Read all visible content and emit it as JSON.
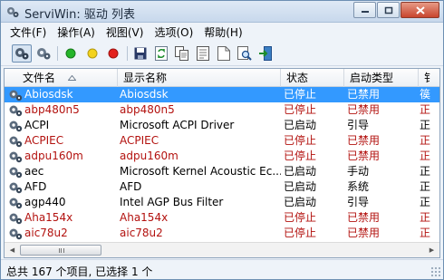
{
  "window": {
    "title": "ServiWin: 驱动 列表",
    "app_icon": "gears-icon"
  },
  "menu": [
    "文件(F)",
    "操作(A)",
    "视图(V)",
    "选项(O)",
    "帮助(H)"
  ],
  "toolbar": {
    "buttons": [
      {
        "name": "drivers-view-icon",
        "pressed": true
      },
      {
        "name": "services-view-icon",
        "pressed": false
      },
      {
        "name": "start-green-icon",
        "pressed": false
      },
      {
        "name": "pause-yellow-icon",
        "pressed": false
      },
      {
        "name": "stop-red-icon",
        "pressed": false
      },
      {
        "name": "save-icon",
        "pressed": false
      },
      {
        "name": "refresh-icon",
        "pressed": false
      },
      {
        "name": "copy-icon",
        "pressed": false
      },
      {
        "name": "properties-icon",
        "pressed": false
      },
      {
        "name": "html-report-icon",
        "pressed": false
      },
      {
        "name": "find-icon",
        "pressed": false
      },
      {
        "name": "exit-icon",
        "pressed": false
      }
    ]
  },
  "columns": [
    "文件名",
    "显示名称",
    "状态",
    "启动类型",
    "钅"
  ],
  "sort_arrow": "up",
  "rows": [
    {
      "file": "Abiosdsk",
      "display": "Abiosdsk",
      "state": "已停止",
      "start": "已禁用",
      "extra": "篌",
      "red": true,
      "selected": true
    },
    {
      "file": "abp480n5",
      "display": "abp480n5",
      "state": "已停止",
      "start": "已禁用",
      "extra": "正",
      "red": true,
      "selected": false
    },
    {
      "file": "ACPI",
      "display": "Microsoft ACPI Driver",
      "state": "已启动",
      "start": "引导",
      "extra": "正",
      "red": false,
      "selected": false
    },
    {
      "file": "ACPIEC",
      "display": "ACPIEC",
      "state": "已停止",
      "start": "已禁用",
      "extra": "正",
      "red": true,
      "selected": false
    },
    {
      "file": "adpu160m",
      "display": "adpu160m",
      "state": "已停止",
      "start": "已禁用",
      "extra": "正",
      "red": true,
      "selected": false
    },
    {
      "file": "aec",
      "display": "Microsoft Kernel Acoustic Ec...",
      "state": "已启动",
      "start": "手动",
      "extra": "正",
      "red": false,
      "selected": false
    },
    {
      "file": "AFD",
      "display": "AFD",
      "state": "已启动",
      "start": "系统",
      "extra": "正",
      "red": false,
      "selected": false
    },
    {
      "file": "agp440",
      "display": "Intel AGP Bus Filter",
      "state": "已启动",
      "start": "引导",
      "extra": "正",
      "red": false,
      "selected": false
    },
    {
      "file": "Aha154x",
      "display": "Aha154x",
      "state": "已停止",
      "start": "已禁用",
      "extra": "正",
      "red": true,
      "selected": false
    },
    {
      "file": "aic78u2",
      "display": "aic78u2",
      "state": "已停止",
      "start": "已禁用",
      "extra": "正",
      "red": true,
      "selected": false
    }
  ],
  "scrollbar": {
    "left_arrow": "◀",
    "right_arrow": "▶"
  },
  "status": "总共 167 个项目, 已选择 1 个",
  "colors": {
    "selection": "#3399ff",
    "stopped_text": "#b3120f",
    "titlebar": "#c8d8ec"
  }
}
